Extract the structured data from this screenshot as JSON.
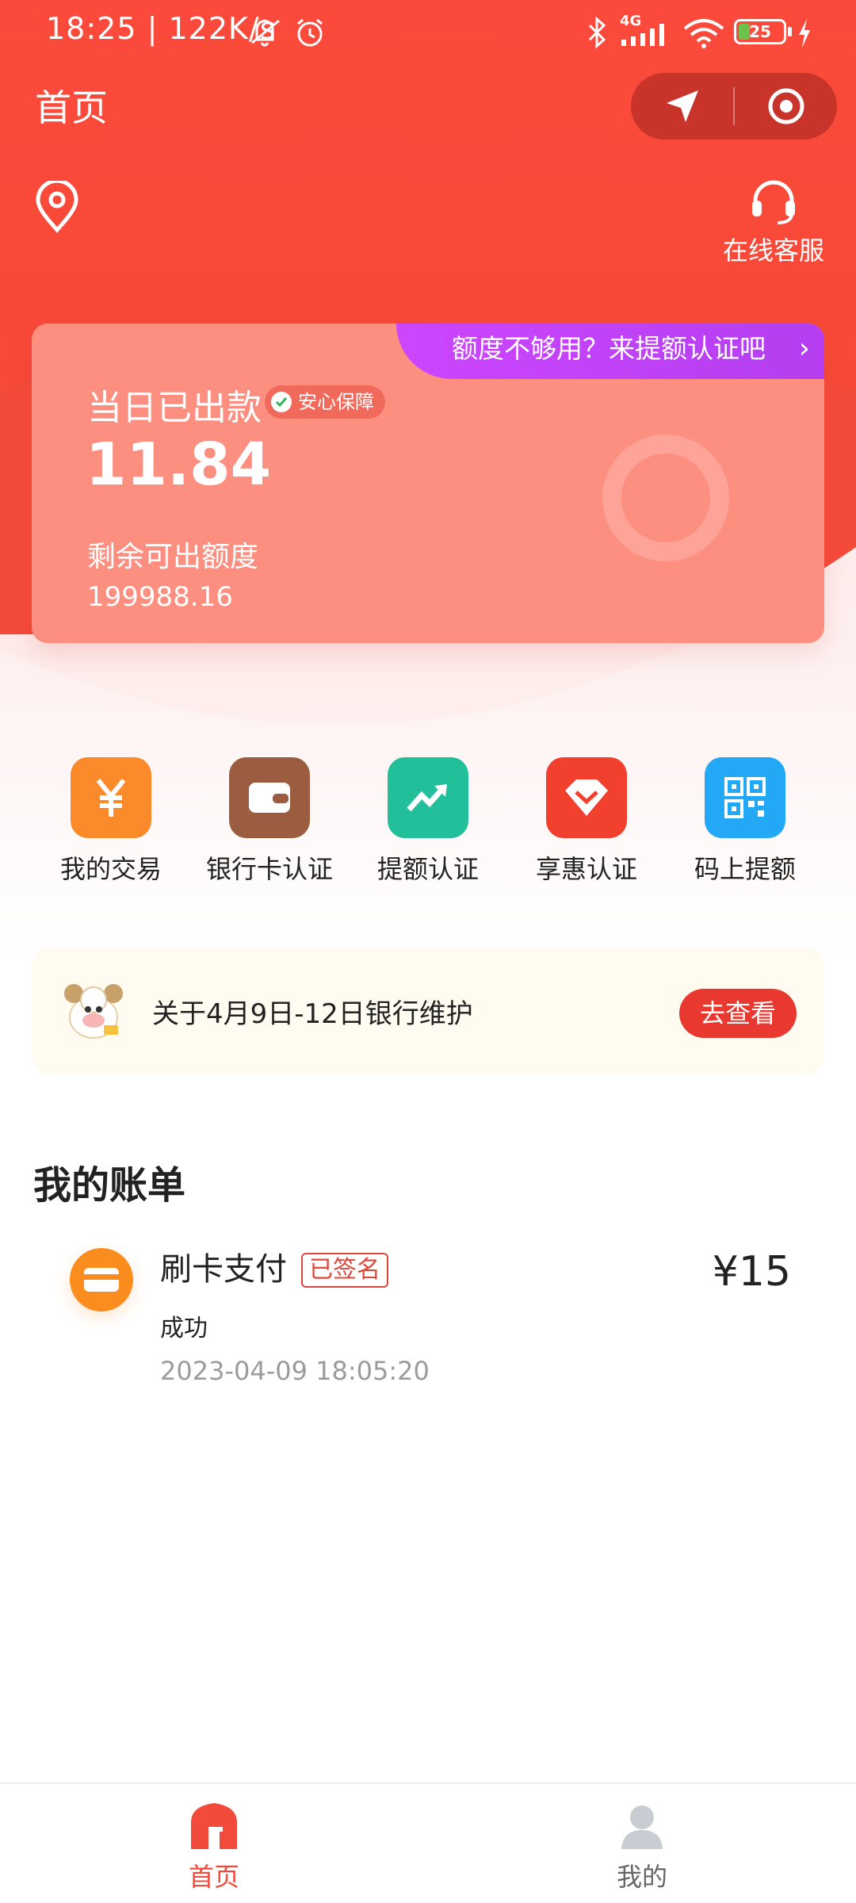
{
  "status_bar": {
    "time": "18:25 | 122K/s",
    "network": "4G",
    "battery": "25",
    "battery_level": 0.25
  },
  "header": {
    "title": "首页",
    "capsule_icons": [
      "navigation-arrow-icon",
      "target-circle-icon"
    ]
  },
  "service": {
    "label": "在线客服",
    "icon": "headset-icon"
  },
  "card": {
    "promo": "额度不够用？来提额认证吧",
    "label": "当日已出款",
    "badge": "安心保障",
    "amount": "11.84",
    "remain_label": "剩余可出额度",
    "remain_value": "199988.16"
  },
  "menu": [
    {
      "label": "我的交易",
      "icon": "yen-icon",
      "color": "#fb8a2a"
    },
    {
      "label": "银行卡认证",
      "icon": "wallet-icon",
      "color": "#9b5c40"
    },
    {
      "label": "提额认证",
      "icon": "trend-up-icon",
      "color": "#22bf9b"
    },
    {
      "label": "享惠认证",
      "icon": "diamond-icon",
      "color": "#f2402f"
    },
    {
      "label": "码上提额",
      "icon": "qr-code-icon",
      "color": "#22a8f5"
    }
  ],
  "notice": {
    "text": "关于4月9日-12日银行维护",
    "button": "去查看"
  },
  "bills": {
    "title": "我的账单",
    "items": [
      {
        "title": "刷卡支付",
        "tag": "已签名",
        "status": "成功",
        "time": "2023-04-09 18:05:20",
        "amount": "¥15"
      }
    ]
  },
  "tabbar": {
    "items": [
      {
        "label": "首页",
        "icon": "home-icon",
        "active": true,
        "color": "#f24a3b"
      },
      {
        "label": "我的",
        "icon": "user-icon",
        "active": false,
        "color": "#888888"
      }
    ]
  }
}
